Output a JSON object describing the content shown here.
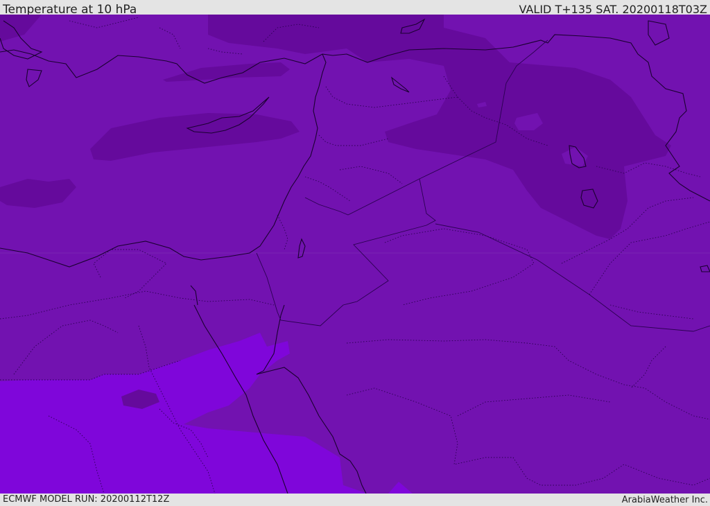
{
  "header": {
    "title": "Temperature at 10 hPa",
    "valid": "VALID T+135 SAT. 20200118T03Z"
  },
  "footer": {
    "model_run": "ECMWF MODEL RUN: 20200112T12Z",
    "brand": "ArabiaWeather Inc."
  },
  "map": {
    "colors": {
      "base": "#7212b0",
      "dark": "#650a9c",
      "light": "#7f06da",
      "coast": "#1a0030",
      "border": "#2a0050"
    }
  }
}
